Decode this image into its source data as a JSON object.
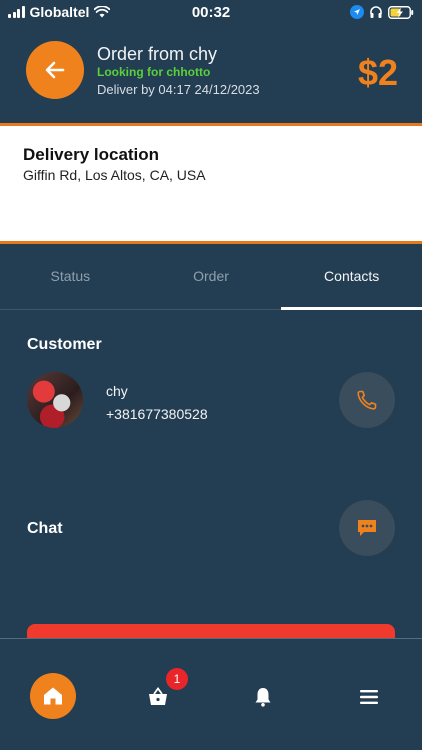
{
  "status_bar": {
    "carrier": "Globaltel",
    "time": "00:32"
  },
  "header": {
    "title": "Order from chy",
    "status": "Looking for chhotto",
    "deliver": "Deliver by 04:17 24/12/2023",
    "price": "$2"
  },
  "location": {
    "title": "Delivery location",
    "address": "Giffin Rd, Los Altos, CA, USA"
  },
  "tabs": [
    {
      "label": "Status",
      "active": false
    },
    {
      "label": "Order",
      "active": false
    },
    {
      "label": "Contacts",
      "active": true
    }
  ],
  "customer": {
    "section_title": "Customer",
    "name": "chy",
    "phone": "+381677380528"
  },
  "chat": {
    "section_title": "Chat"
  },
  "bottom_nav": {
    "cart_badge": "1"
  },
  "colors": {
    "accent": "#f0821e",
    "background": "#233d52",
    "status_green": "#5ad03c",
    "alert_red": "#f03a2e"
  },
  "icons": [
    "back-arrow-icon",
    "phone-icon",
    "chat-bubble-icon",
    "home-icon",
    "basket-icon",
    "bell-icon",
    "menu-icon"
  ]
}
